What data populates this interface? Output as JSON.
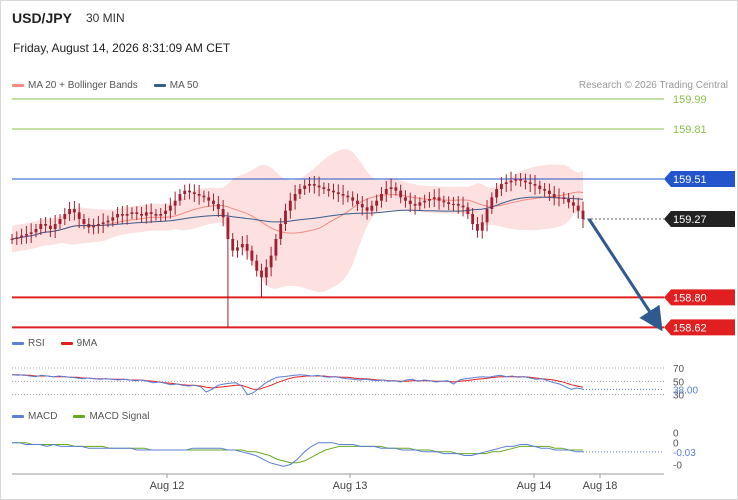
{
  "header": {
    "symbol": "USD/JPY",
    "timeframe": "30 MIN",
    "datetime": "Friday, August 14, 2026 8:31:09 AM CET",
    "copyright": "Research © 2026 Trading Central"
  },
  "colors": {
    "ma20": "#f28b82",
    "band_fill": "#fde0e0",
    "ma50": "#3a5b8c",
    "candle": "#a02030",
    "resistance": "#2255cc",
    "support": "#e02020",
    "target_green": "#8bc34a",
    "rsi": "#5b7fd6",
    "rsi_ma": "#e02020",
    "macd": "#5b7fd6",
    "macd_signal": "#66aa22",
    "forecast_arrow": "#2f5a8f"
  },
  "chart_data": [
    {
      "type": "candlestick",
      "title": "USD/JPY",
      "legend": [
        {
          "name": "MA 20 + Bollinger Bands",
          "color": "#f28b82"
        },
        {
          "name": "MA 50",
          "color": "#3a5b8c"
        }
      ],
      "x_ticks": [
        "Aug 12",
        "Aug 13",
        "Aug 14",
        "Aug 18"
      ],
      "levels": [
        {
          "value": 159.99,
          "label": "159.99",
          "kind": "target"
        },
        {
          "value": 159.81,
          "label": "159.81",
          "kind": "target"
        },
        {
          "value": 159.51,
          "label": "159.51",
          "kind": "resistance"
        },
        {
          "value": 159.27,
          "label": "159.27",
          "kind": "last"
        },
        {
          "value": 158.8,
          "label": "158.80",
          "kind": "support"
        },
        {
          "value": 158.62,
          "label": "158.62",
          "kind": "support"
        }
      ],
      "ylim": [
        158.58,
        160.08
      ],
      "forecast": {
        "from": 159.27,
        "to": 158.62
      },
      "close_series": [
        159.15,
        159.16,
        159.17,
        159.18,
        159.19,
        159.21,
        159.24,
        159.23,
        159.21,
        159.24,
        159.27,
        159.3,
        159.33,
        159.31,
        159.27,
        159.24,
        159.22,
        159.23,
        159.24,
        159.25,
        159.26,
        159.28,
        159.3,
        159.29,
        159.3,
        159.31,
        159.3,
        159.29,
        159.31,
        159.3,
        159.29,
        159.3,
        159.32,
        159.35,
        159.38,
        159.42,
        159.44,
        159.43,
        159.42,
        159.41,
        159.4,
        159.38,
        159.36,
        159.33,
        159.28,
        159.15,
        159.08,
        159.1,
        159.12,
        159.08,
        159.02,
        158.96,
        158.92,
        158.98,
        159.05,
        159.15,
        159.24,
        159.32,
        159.38,
        159.42,
        159.45,
        159.47,
        159.48,
        159.47,
        159.46,
        159.45,
        159.44,
        159.43,
        159.42,
        159.41,
        159.4,
        159.38,
        159.36,
        159.34,
        159.32,
        159.35,
        159.38,
        159.42,
        159.45,
        159.46,
        159.44,
        159.4,
        159.38,
        159.36,
        159.35,
        159.37,
        159.38,
        159.39,
        159.4,
        159.38,
        159.37,
        159.36,
        159.36,
        159.35,
        159.34,
        159.3,
        159.24,
        159.2,
        159.25,
        159.33,
        159.4,
        159.45,
        159.48,
        159.49,
        159.5,
        159.51,
        159.5,
        159.49,
        159.48,
        159.47,
        159.45,
        159.44,
        159.42,
        159.4,
        159.4,
        159.39,
        159.37,
        159.35,
        159.32,
        159.27
      ]
    },
    {
      "type": "line",
      "title": "RSI",
      "legend": [
        {
          "name": "RSI",
          "color": "#5b7fd6"
        },
        {
          "name": "9MA",
          "color": "#e02020"
        }
      ],
      "levels": [
        {
          "value": 70,
          "label": "70"
        },
        {
          "value": 50,
          "label": "50"
        },
        {
          "value": 30,
          "label": "30"
        }
      ],
      "last_value": "38.00",
      "ylim": [
        25,
        82
      ],
      "rsi": [
        60,
        59,
        60,
        58,
        57,
        59,
        58,
        57,
        58,
        57,
        56,
        55,
        54,
        55,
        54,
        53,
        54,
        53,
        52,
        53,
        52,
        51,
        52,
        50,
        48,
        49,
        47,
        45,
        46,
        44,
        43,
        44,
        42,
        34,
        38,
        44,
        46,
        47,
        48,
        43,
        30,
        33,
        40,
        47,
        52,
        56,
        57,
        58,
        59,
        60,
        59,
        58,
        59,
        57,
        56,
        57,
        55,
        54,
        53,
        52,
        53,
        52,
        51,
        52,
        50,
        51,
        49,
        52,
        53,
        50,
        52,
        51,
        49,
        50,
        51,
        46,
        52,
        54,
        55,
        56,
        57,
        56,
        58,
        59,
        57,
        58,
        56,
        57,
        55,
        53,
        54,
        51,
        48,
        46,
        42,
        38,
        40,
        38
      ],
      "ma9": [
        60,
        60,
        59,
        59,
        58,
        58,
        58,
        57,
        57,
        57,
        56,
        56,
        55,
        55,
        54,
        54,
        54,
        53,
        53,
        53,
        52,
        52,
        52,
        51,
        50,
        49,
        48,
        47,
        46,
        45,
        44,
        44,
        43,
        41,
        40,
        41,
        42,
        43,
        44,
        44,
        41,
        38,
        38,
        41,
        44,
        48,
        51,
        54,
        56,
        57,
        58,
        58,
        58,
        58,
        57,
        57,
        56,
        56,
        55,
        54,
        54,
        53,
        52,
        52,
        51,
        51,
        50,
        50,
        51,
        51,
        51,
        51,
        50,
        50,
        50,
        49,
        50,
        51,
        52,
        53,
        54,
        55,
        56,
        57,
        57,
        57,
        57,
        57,
        56,
        55,
        54,
        53,
        52,
        50,
        48,
        45,
        43,
        41
      ]
    },
    {
      "type": "line",
      "title": "MACD",
      "legend": [
        {
          "name": "MACD",
          "color": "#5b7fd6"
        },
        {
          "name": "MACD Signal",
          "color": "#66aa22"
        }
      ],
      "y_ticks": [
        "0",
        "0",
        "-0"
      ],
      "last_value": "-0.03",
      "ylim": [
        -0.15,
        0.07
      ],
      "macd": [
        0.0,
        0.0,
        -0.01,
        -0.01,
        -0.01,
        -0.02,
        -0.01,
        -0.02,
        -0.02,
        -0.02,
        -0.02,
        -0.03,
        -0.03,
        -0.03,
        -0.03,
        -0.03,
        -0.03,
        -0.03,
        -0.04,
        -0.04,
        -0.04,
        -0.04,
        -0.04,
        -0.04,
        -0.04,
        -0.04,
        -0.03,
        -0.03,
        -0.03,
        -0.03,
        -0.03,
        -0.04,
        -0.04,
        -0.05,
        -0.06,
        -0.07,
        -0.09,
        -0.11,
        -0.12,
        -0.13,
        -0.12,
        -0.09,
        -0.05,
        -0.02,
        0.0,
        0.0,
        0.0,
        -0.01,
        -0.01,
        -0.01,
        -0.02,
        -0.02,
        -0.02,
        -0.03,
        -0.03,
        -0.03,
        -0.04,
        -0.04,
        -0.04,
        -0.05,
        -0.05,
        -0.05,
        -0.06,
        -0.06,
        -0.06,
        -0.07,
        -0.07,
        -0.06,
        -0.05,
        -0.04,
        -0.03,
        -0.02,
        -0.02,
        -0.01,
        -0.01,
        -0.02,
        -0.03,
        -0.03,
        -0.04,
        -0.04,
        -0.04,
        -0.05,
        -0.05
      ],
      "signal": [
        0.0,
        0.0,
        0.0,
        -0.01,
        -0.01,
        -0.01,
        -0.01,
        -0.01,
        -0.01,
        -0.02,
        -0.02,
        -0.02,
        -0.02,
        -0.02,
        -0.03,
        -0.03,
        -0.03,
        -0.03,
        -0.03,
        -0.03,
        -0.04,
        -0.04,
        -0.04,
        -0.04,
        -0.04,
        -0.04,
        -0.04,
        -0.04,
        -0.04,
        -0.04,
        -0.04,
        -0.04,
        -0.04,
        -0.04,
        -0.05,
        -0.05,
        -0.06,
        -0.07,
        -0.09,
        -0.1,
        -0.11,
        -0.11,
        -0.1,
        -0.08,
        -0.06,
        -0.04,
        -0.03,
        -0.02,
        -0.02,
        -0.02,
        -0.02,
        -0.02,
        -0.02,
        -0.02,
        -0.03,
        -0.03,
        -0.03,
        -0.03,
        -0.04,
        -0.04,
        -0.04,
        -0.05,
        -0.05,
        -0.05,
        -0.06,
        -0.06,
        -0.06,
        -0.06,
        -0.06,
        -0.05,
        -0.05,
        -0.04,
        -0.03,
        -0.02,
        -0.02,
        -0.02,
        -0.02,
        -0.02,
        -0.03,
        -0.03,
        -0.04,
        -0.04,
        -0.04
      ]
    }
  ]
}
